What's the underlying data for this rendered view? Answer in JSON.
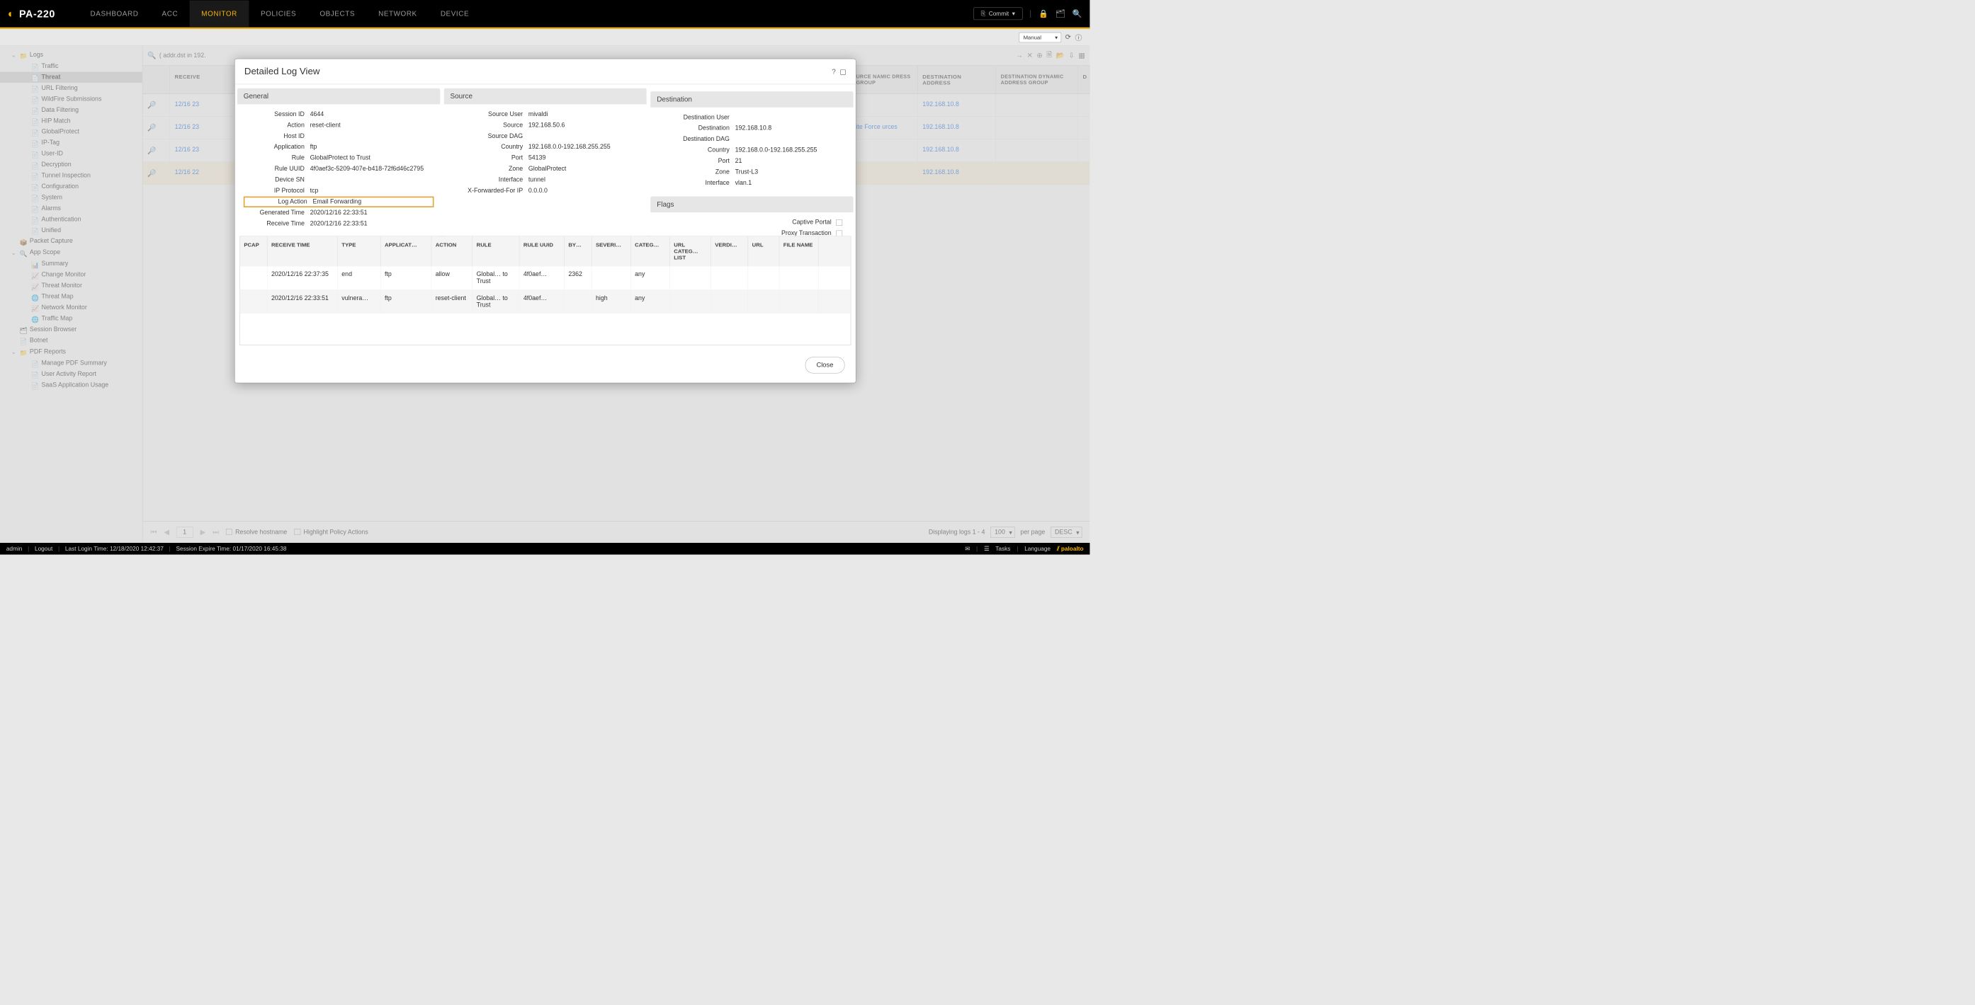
{
  "header": {
    "device": "PA-220",
    "tabs": [
      "DASHBOARD",
      "ACC",
      "MONITOR",
      "POLICIES",
      "OBJECTS",
      "NETWORK",
      "DEVICE"
    ],
    "active_tab": "MONITOR",
    "commit_label": "Commit"
  },
  "subtool": {
    "refresh_mode": "Manual"
  },
  "sidebar": {
    "nodes": [
      {
        "label": "Logs",
        "lvl": 1,
        "exp": "⌄",
        "icon": "📁"
      },
      {
        "label": "Traffic",
        "lvl": 2,
        "icon": "📄"
      },
      {
        "label": "Threat",
        "lvl": 2,
        "icon": "📄",
        "sel": true
      },
      {
        "label": "URL Filtering",
        "lvl": 2,
        "icon": "📄"
      },
      {
        "label": "WildFire Submissions",
        "lvl": 2,
        "icon": "📄"
      },
      {
        "label": "Data Filtering",
        "lvl": 2,
        "icon": "📄"
      },
      {
        "label": "HIP Match",
        "lvl": 2,
        "icon": "📄"
      },
      {
        "label": "GlobalProtect",
        "lvl": 2,
        "icon": "📄"
      },
      {
        "label": "IP-Tag",
        "lvl": 2,
        "icon": "📄"
      },
      {
        "label": "User-ID",
        "lvl": 2,
        "icon": "📄"
      },
      {
        "label": "Decryption",
        "lvl": 2,
        "icon": "📄"
      },
      {
        "label": "Tunnel Inspection",
        "lvl": 2,
        "icon": "📄"
      },
      {
        "label": "Configuration",
        "lvl": 2,
        "icon": "📄"
      },
      {
        "label": "System",
        "lvl": 2,
        "icon": "📄"
      },
      {
        "label": "Alarms",
        "lvl": 2,
        "icon": "📄"
      },
      {
        "label": "Authentication",
        "lvl": 2,
        "icon": "📄"
      },
      {
        "label": "Unified",
        "lvl": 2,
        "icon": "📄"
      },
      {
        "label": "Packet Capture",
        "lvl": 1,
        "icon": "📦"
      },
      {
        "label": "App Scope",
        "lvl": 1,
        "exp": "⌄",
        "icon": "🔍"
      },
      {
        "label": "Summary",
        "lvl": 2,
        "icon": "📊"
      },
      {
        "label": "Change Monitor",
        "lvl": 2,
        "icon": "📈"
      },
      {
        "label": "Threat Monitor",
        "lvl": 2,
        "icon": "📈"
      },
      {
        "label": "Threat Map",
        "lvl": 2,
        "icon": "🌐"
      },
      {
        "label": "Network Monitor",
        "lvl": 2,
        "icon": "📈"
      },
      {
        "label": "Traffic Map",
        "lvl": 2,
        "icon": "🌐"
      },
      {
        "label": "Session Browser",
        "lvl": 1,
        "icon": "🗂"
      },
      {
        "label": "Botnet",
        "lvl": 1,
        "icon": "📄"
      },
      {
        "label": "PDF Reports",
        "lvl": 1,
        "exp": "⌄",
        "icon": "📁"
      },
      {
        "label": "Manage PDF Summary",
        "lvl": 2,
        "icon": "📄"
      },
      {
        "label": "User Activity Report",
        "lvl": 2,
        "icon": "📄"
      },
      {
        "label": "SaaS Application Usage",
        "lvl": 2,
        "icon": "📄"
      }
    ]
  },
  "filter": {
    "query": "( addr.dst in 192."
  },
  "log_columns_visible_left": [
    "",
    "RECEIVE"
  ],
  "log_columns_visible_right": [
    "URCE NAMIC DRESS GROUP",
    "DESTINATION ADDRESS",
    "DESTINATION DYNAMIC ADDRESS GROUP",
    "D"
  ],
  "log_rows": [
    {
      "recv": "12/16 23",
      "tag": "",
      "dest": "192.168.10.8"
    },
    {
      "recv": "12/16 23",
      "tag": "ite Force urces",
      "dest": "192.168.10.8"
    },
    {
      "recv": "12/16 23",
      "tag": "",
      "dest": "192.168.10.8"
    },
    {
      "recv": "12/16 22",
      "tag": "",
      "dest": "192.168.10.8",
      "sel": true
    }
  ],
  "pager": {
    "page": "1",
    "resolve": "Resolve hostname",
    "highlight": "Highlight Policy Actions",
    "displaying": "Displaying logs 1 - 4",
    "per_page_val": "100",
    "per_page_label": "per page",
    "sort": "DESC"
  },
  "footer": {
    "user": "admin",
    "logout": "Logout",
    "last_login": "Last Login Time: 12/18/2020 12:42:37",
    "expire": "Session Expire Time: 01/17/2020 16:45:38",
    "tasks": "Tasks",
    "language": "Language",
    "brand": "paloalto"
  },
  "modal": {
    "title": "Detailed Log View",
    "general_title": "General",
    "source_title": "Source",
    "dest_title": "Destination",
    "flags_title": "Flags",
    "general": [
      {
        "k": "Session ID",
        "v": "4644"
      },
      {
        "k": "Action",
        "v": "reset-client"
      },
      {
        "k": "Host ID",
        "v": ""
      },
      {
        "k": "Application",
        "v": "ftp"
      },
      {
        "k": "Rule",
        "v": "GlobalProtect to Trust"
      },
      {
        "k": "Rule UUID",
        "v": "4f0aef3c-5209-407e-b418-72f6d46c2795"
      },
      {
        "k": "Device SN",
        "v": ""
      },
      {
        "k": "IP Protocol",
        "v": "tcp"
      },
      {
        "k": "Log Action",
        "v": "Email Forwarding",
        "hl": true
      },
      {
        "k": "Generated Time",
        "v": "2020/12/16 22:33:51"
      },
      {
        "k": "Receive Time",
        "v": "2020/12/16 22:33:51"
      }
    ],
    "source": [
      {
        "k": "Source User",
        "v": "mivaldi"
      },
      {
        "k": "Source",
        "v": "192.168.50.6"
      },
      {
        "k": "Source DAG",
        "v": ""
      },
      {
        "k": "Country",
        "v": "192.168.0.0-192.168.255.255"
      },
      {
        "k": "Port",
        "v": "54139"
      },
      {
        "k": "Zone",
        "v": "GlobalProtect"
      },
      {
        "k": "Interface",
        "v": "tunnel"
      },
      {
        "k": "X-Forwarded-For IP",
        "v": "0.0.0.0"
      }
    ],
    "destination": [
      {
        "k": "Destination User",
        "v": ""
      },
      {
        "k": "Destination",
        "v": "192.168.10.8"
      },
      {
        "k": "Destination DAG",
        "v": ""
      },
      {
        "k": "Country",
        "v": "192.168.0.0-192.168.255.255"
      },
      {
        "k": "Port",
        "v": "21"
      },
      {
        "k": "Zone",
        "v": "Trust-L3"
      },
      {
        "k": "Interface",
        "v": "vlan.1"
      }
    ],
    "flags": [
      "Captive Portal",
      "Proxy Transaction"
    ],
    "table_cols": [
      "PCAP",
      "RECEIVE TIME",
      "TYPE",
      "APPLICAT…",
      "ACTION",
      "RULE",
      "RULE UUID",
      "BY…",
      "SEVERI…",
      "CATEG…",
      "URL CATEG… LIST",
      "VERDI…",
      "URL",
      "FILE NAME"
    ],
    "table_widths": [
      70,
      180,
      110,
      130,
      105,
      120,
      115,
      70,
      100,
      100,
      105,
      95,
      80,
      100
    ],
    "table_rows": [
      {
        "cells": [
          "",
          "2020/12/16 22:37:35",
          "end",
          "ftp",
          "allow",
          "Global… to Trust",
          "4f0aef…",
          "2362",
          "",
          "any",
          "",
          "",
          "",
          ""
        ]
      },
      {
        "cells": [
          "",
          "2020/12/16 22:33:51",
          "vulnera…",
          "ftp",
          "reset-client",
          "Global… to Trust",
          "4f0aef…",
          "",
          "high",
          "any",
          "",
          "",
          "",
          ""
        ],
        "alt": true
      }
    ],
    "close": "Close"
  }
}
